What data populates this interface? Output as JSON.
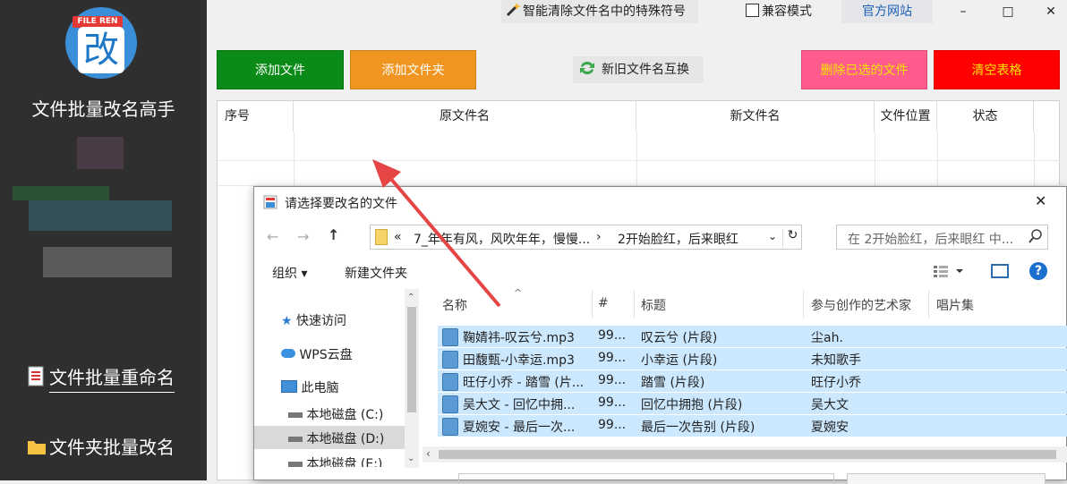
{
  "sidebar": {
    "logo_badge": "FILE REN",
    "logo_char": "改",
    "app_title": "文件批量改名高手",
    "nav_items": [
      {
        "label": "文件批量重命名",
        "icon": "document-icon"
      },
      {
        "label": "文件夹批量改名",
        "icon": "folder-icon"
      }
    ]
  },
  "topbar": {
    "clean_label": "智能清除文件名中的特殊符号",
    "compat_label": "兼容模式",
    "website_label": "官方网站",
    "minimize": "–",
    "maximize": "□",
    "close": "✕"
  },
  "actions": {
    "add_file": "添加文件",
    "add_folder": "添加文件夹",
    "swap": "新旧文件名互换",
    "delete_selected": "删除已选的文件",
    "clear_table": "清空表格"
  },
  "table": {
    "headers": [
      "序号",
      "原文件名",
      "新文件名",
      "文件位置",
      "状态"
    ]
  },
  "dialog": {
    "title": "请选择要改名的文件",
    "close": "✕",
    "address": {
      "prefix": "«",
      "crumb1": "7_年年有风，风吹年年，慢慢...",
      "sep": "›",
      "crumb2": "2开始脸红，后来眼红"
    },
    "search_placeholder": "在 2开始脸红，后来眼红 中...",
    "organize": "组织 ▾",
    "new_folder": "新建文件夹",
    "nav_tree": [
      {
        "label": "快速访问",
        "icon": "star-icon"
      },
      {
        "label": "WPS云盘",
        "icon": "cloud-icon"
      },
      {
        "label": "此电脑",
        "icon": "computer-icon"
      },
      {
        "label": "本地磁盘 (C:)",
        "icon": "drive-icon"
      },
      {
        "label": "本地磁盘 (D:)",
        "icon": "drive-icon"
      },
      {
        "label": "本地磁盘 (E:)",
        "icon": "drive-icon"
      }
    ],
    "columns": [
      "名称",
      "#",
      "标题",
      "参与创作的艺术家",
      "唱片集"
    ],
    "files": [
      {
        "name": "鞠婧祎-叹云兮.mp3",
        "num": "99...",
        "title": "叹云兮 (片段)",
        "artist": "尘ah."
      },
      {
        "name": "田馥甄-小幸运.mp3",
        "num": "99...",
        "title": "小幸运 (片段)",
        "artist": "未知歌手"
      },
      {
        "name": "旺仔小乔 - 踏雪 (片...",
        "num": "99...",
        "title": "踏雪 (片段)",
        "artist": "旺仔小乔"
      },
      {
        "name": "吴大文 - 回忆中拥...",
        "num": "99...",
        "title": "回忆中拥抱 (片段)",
        "artist": "吴大文"
      },
      {
        "name": "夏婉安 - 最后一次...",
        "num": "99...",
        "title": "最后一次告别 (片段)",
        "artist": "夏婉安"
      }
    ]
  },
  "colors": {
    "sidebar_bg": "#2f2f2f",
    "add_file": "#0a8a16",
    "add_folder": "#f0951f",
    "delete_selected": "#ff5b8d",
    "clear_table": "#ff0000",
    "selection": "#cce8ff",
    "arrow": "#e64545"
  }
}
